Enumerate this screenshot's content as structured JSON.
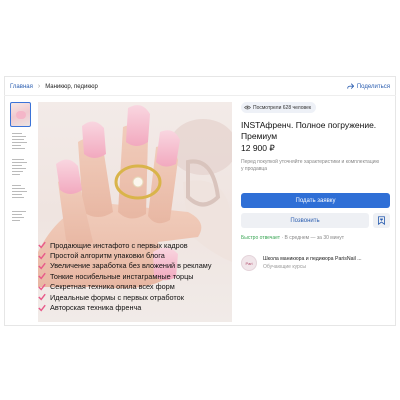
{
  "breadcrumb": {
    "home": "Главная",
    "current": "Маникюр, педикюр"
  },
  "share_label": "Поделиться",
  "views_label": "Посмотрели 628 человек",
  "product": {
    "title": "INSTAфренч. Полное погружение. Премиум",
    "price": "12 900 ₽",
    "note": "Перед покупкой уточняйте характеристики и комплектацию у продавца"
  },
  "actions": {
    "submit_label": "Подать заявку",
    "call_label": "Позвонить"
  },
  "reply": {
    "fast": "Быстро отвечает",
    "rest": " · В среднем — за 30 минут"
  },
  "seller": {
    "name": "Школа маникюра и педикюра ParisNail ...",
    "type": "Обучающие курсы",
    "avatar_text": "Pari"
  },
  "features": [
    "Продающие инстафото с первых кадров",
    "Простой алгоритм упаковки блога",
    "Увеличение заработка без вложений в рекламу",
    "Тонкие носибельные инстаграмные торцы",
    "Секретная техника опила всех форм",
    "Идеальные формы с первых отработок",
    "Авторская техника френча"
  ],
  "colors": {
    "accent": "#2f6fd6",
    "link": "#2a5db0",
    "fast_reply": "#3aa655",
    "nail_pink": "#f4b6c8"
  },
  "icons": {
    "share": "share-icon",
    "eye": "eye-icon",
    "heart": "heart-bookmark-icon",
    "check": "check-icon"
  }
}
